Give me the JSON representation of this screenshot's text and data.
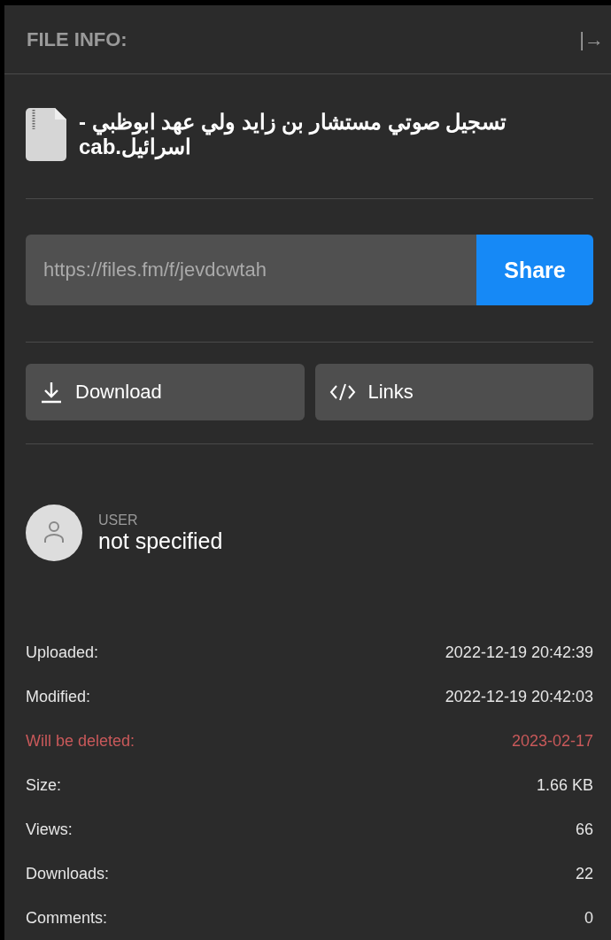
{
  "header": {
    "title": "FILE INFO:",
    "collapse_icon": "|→"
  },
  "file": {
    "name": "تسجيل صوتي مستشار بن زايد ولي عهد ابوظبي - اسرائيل.cab"
  },
  "share": {
    "url": "https://files.fm/f/jevdcwtah",
    "button": "Share"
  },
  "actions": [
    {
      "kind": "download",
      "label": "Download"
    },
    {
      "kind": "links",
      "label": "Links"
    }
  ],
  "user": {
    "caption": "USER",
    "name": "not specified"
  },
  "stats": [
    {
      "label": "Uploaded:",
      "value": "2022-12-19 20:42:39",
      "kind": "normal"
    },
    {
      "label": "Modified:",
      "value": "2022-12-19 20:42:03",
      "kind": "normal"
    },
    {
      "label": "Will be deleted:",
      "value": "2023-02-17",
      "kind": "warning"
    },
    {
      "label": "Size:",
      "value": "1.66 KB",
      "kind": "normal"
    },
    {
      "label": "Views:",
      "value": "66",
      "kind": "normal"
    },
    {
      "label": "Downloads:",
      "value": "22",
      "kind": "normal"
    },
    {
      "label": "Comments:",
      "value": "0",
      "kind": "normal"
    }
  ]
}
